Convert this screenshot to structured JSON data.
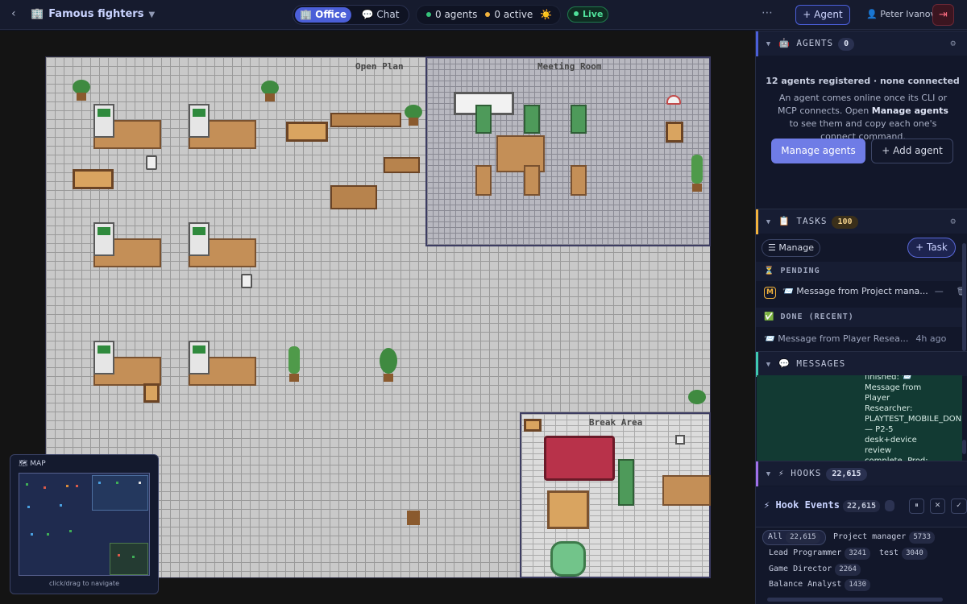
{
  "topbar": {
    "back_icon": "chevron-left-icon",
    "project_icon": "building-icon",
    "project_name": "Famous fighters",
    "view_tabs": [
      {
        "label": "Office",
        "icon": "building-icon",
        "active": true
      },
      {
        "label": "Chat",
        "icon": "speech-bubble-icon",
        "active": false
      }
    ],
    "agents_status": "0 agents",
    "active_status": "0 active",
    "weather_icon": "sun-icon",
    "live_label": "Live",
    "more_label": "⋯",
    "add_agent_label": "+ Agent",
    "user_name": "Peter Ivanov",
    "colors": {
      "accent": "#4b5fd8",
      "live": "#4fe09a",
      "logout": "#ff6d82"
    }
  },
  "office": {
    "zones": {
      "open_plan": "Open Plan",
      "meeting_room": "Meeting Room",
      "break_area": "Break Area"
    }
  },
  "minimap": {
    "title": "MAP",
    "footer": "click/drag to navigate"
  },
  "sidebar": {
    "agents": {
      "title": "AGENTS",
      "count": "0",
      "registered": "12 agents registered · none connected",
      "desc_1": "An agent comes online once its CLI or MCP connects. Open ",
      "desc_bold": "Manage agents",
      "desc_2": " to see them and copy each one's connect command.",
      "manage_btn": "Manage agents",
      "add_btn": "+ Add agent"
    },
    "tasks": {
      "title": "TASKS",
      "count": "100",
      "manage_btn": "☰ Manage",
      "add_btn": "+ Task",
      "pending_label": "PENDING",
      "pending_item": {
        "avatar": "M",
        "text": "📨 Message from Project mana...",
        "status": "—"
      },
      "done_label": "DONE (RECENT)",
      "done_item": {
        "text": "📨 Message from Player Resea...",
        "time": "4h ago"
      }
    },
    "messages": {
      "title": "MESSAGES",
      "preview": "finished: 📨 Message from Player Researcher: PLAYTEST_MOBILE_DONE — P2-5 desk+device review complete. Prod: https://ff...."
    },
    "hooks": {
      "title": "HOOKS",
      "count": "22,615",
      "panel_title": "Hook Events",
      "panel_count": "22,615",
      "filters": [
        {
          "label": "All",
          "count": "22,615",
          "selected": true
        },
        {
          "label": "Project manager",
          "count": "5733"
        },
        {
          "label": "Lead Programmer",
          "count": "3241"
        },
        {
          "label": "test",
          "count": "3040"
        },
        {
          "label": "Game Director",
          "count": "2264"
        },
        {
          "label": "Balance Analyst",
          "count": "1430"
        }
      ]
    }
  }
}
